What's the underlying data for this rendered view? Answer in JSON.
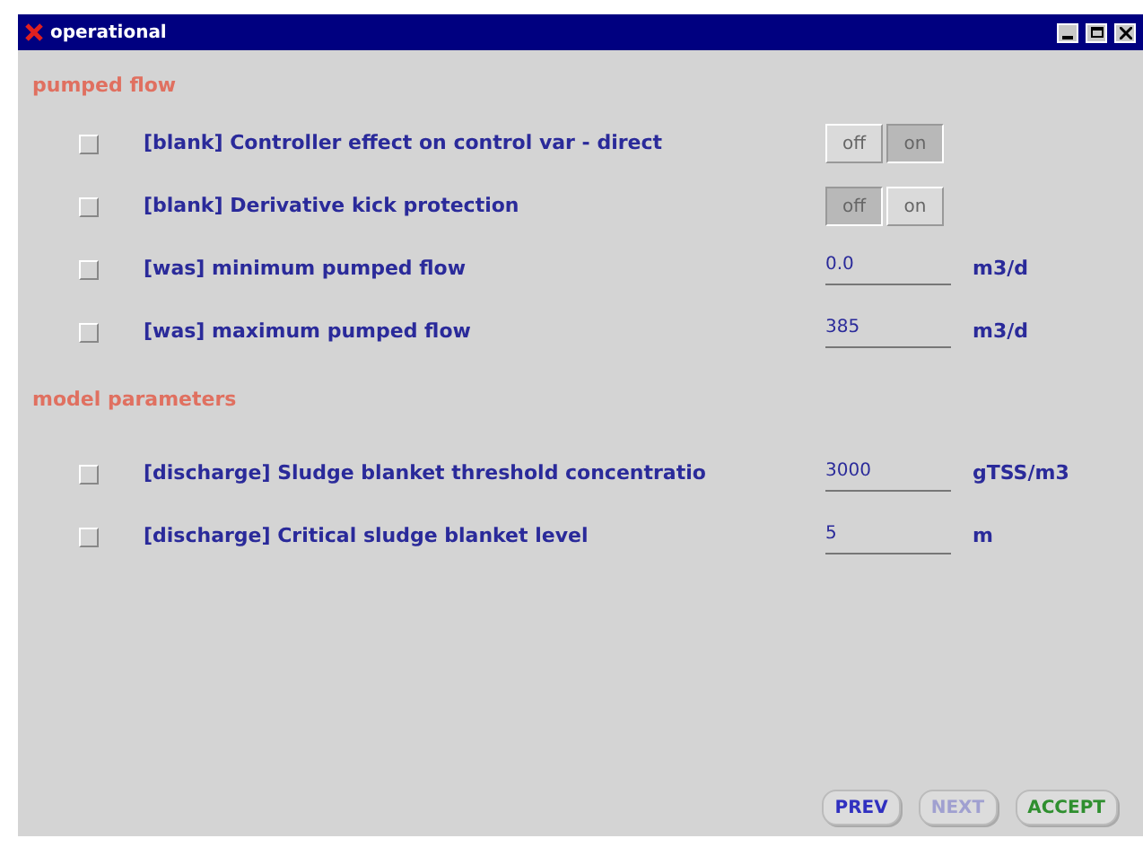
{
  "window": {
    "title": "operational"
  },
  "sections": [
    {
      "title": "pumped flow",
      "rows": [
        {
          "kind": "toggle",
          "checked": false,
          "label": "[blank] Controller effect on control var - direct",
          "options": [
            {
              "label": "off",
              "selected": false
            },
            {
              "label": "on",
              "selected": true
            }
          ]
        },
        {
          "kind": "toggle",
          "checked": false,
          "label": "[blank] Derivative kick protection",
          "options": [
            {
              "label": "off",
              "selected": true
            },
            {
              "label": "on",
              "selected": false
            }
          ]
        },
        {
          "kind": "field",
          "checked": false,
          "label": "[was] minimum pumped flow",
          "value": "0.0",
          "unit": "m3/d"
        },
        {
          "kind": "field",
          "checked": false,
          "label": "[was] maximum pumped flow",
          "value": "385",
          "unit": "m3/d"
        }
      ]
    },
    {
      "title": "model parameters",
      "rows": [
        {
          "kind": "field",
          "checked": false,
          "label": "[discharge] Sludge blanket threshold concentratio",
          "value": "3000",
          "unit": "gTSS/m3"
        },
        {
          "kind": "field",
          "checked": false,
          "label": "[discharge] Critical sludge blanket level",
          "value": "5",
          "unit": "m"
        }
      ]
    }
  ],
  "buttons": [
    {
      "label": "PREV",
      "disabled": false,
      "kind": "prev"
    },
    {
      "label": "NEXT",
      "disabled": true,
      "kind": "next"
    },
    {
      "label": "ACCEPT",
      "disabled": false,
      "kind": "accept"
    }
  ]
}
